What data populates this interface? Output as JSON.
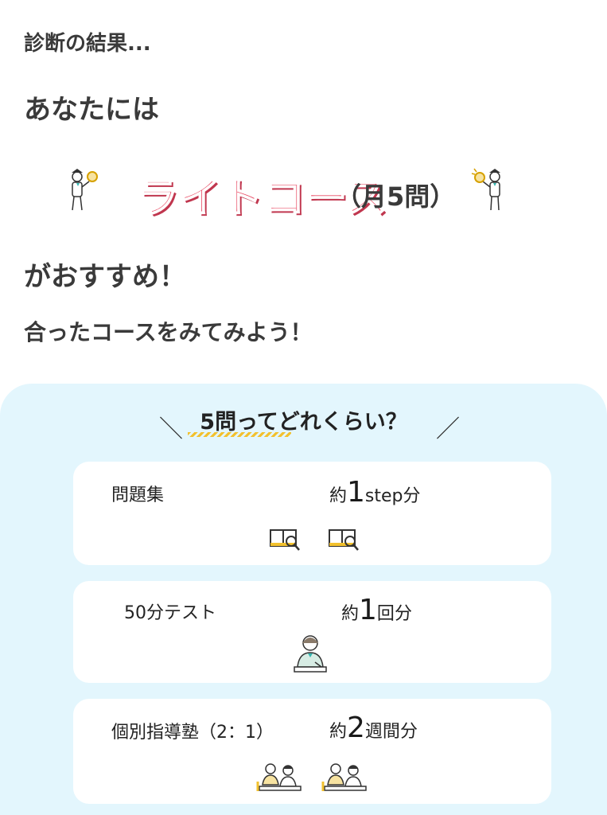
{
  "intro": {
    "result_label": "診断の結果...",
    "anata": "あなたには",
    "course_name": "ライトコース",
    "course_sub": "（月5問）",
    "osusume": "がおすすめ！",
    "minasai": "合ったコースをみてみよう！"
  },
  "panel": {
    "title": "5問ってどれくらい？",
    "slash_left": "＼",
    "slash_right": "／",
    "cards": [
      {
        "label": "問題集",
        "prefix": "約",
        "big": "1",
        "unit": "step",
        "suffix": "分"
      },
      {
        "label": "50分テスト",
        "prefix": "約",
        "big": "1",
        "unit": "回",
        "suffix": "分"
      },
      {
        "label": "個別指導塾（2：1）",
        "prefix": "約",
        "big": "2",
        "unit": "週間",
        "suffix": "分"
      }
    ]
  },
  "colors": {
    "accent_pink": "#e84862",
    "panel_bg": "#e3f6fd",
    "stripe": "#f2c12e"
  },
  "icons": {
    "mascot": "detective-student-icon",
    "book": "book-magnifier-icon",
    "student": "student-desk-icon",
    "teacher": "tutor-students-icon"
  }
}
